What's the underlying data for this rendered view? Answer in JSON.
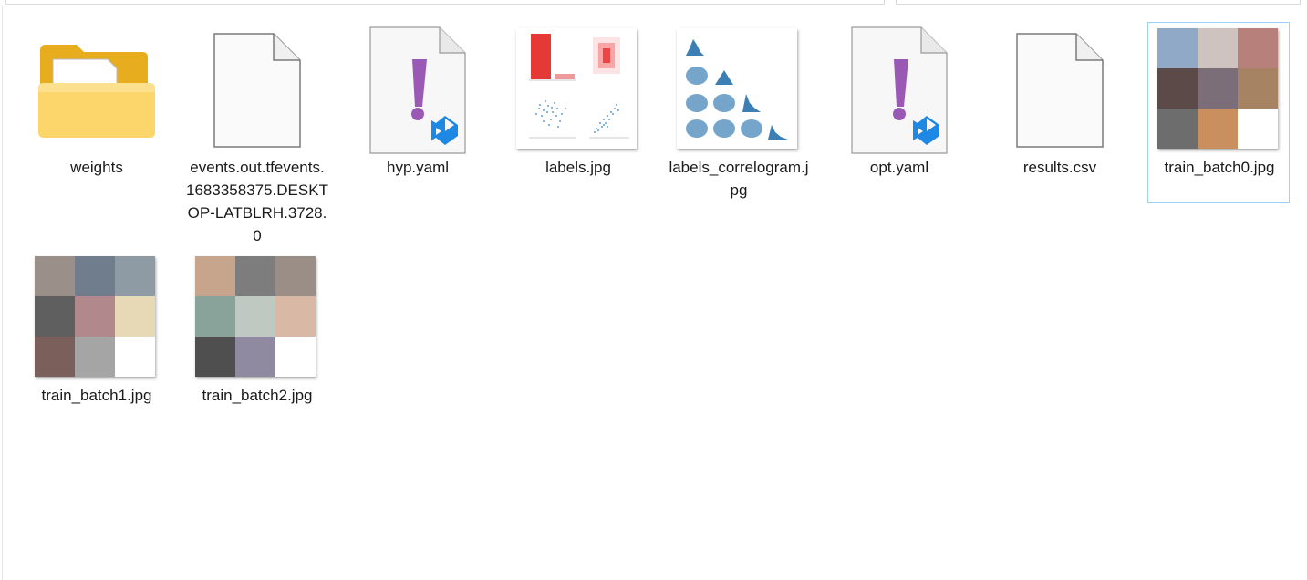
{
  "items": [
    {
      "name": "weights",
      "kind": "folder"
    },
    {
      "name": "events.out.tfevents.1683358375.DESKTOP-LATBLRH.3728.0",
      "kind": "blank-file"
    },
    {
      "name": "hyp.yaml",
      "kind": "yaml-vscode"
    },
    {
      "name": "labels.jpg",
      "kind": "image-labels"
    },
    {
      "name": "labels_correlogram.jpg",
      "kind": "image-correlogram"
    },
    {
      "name": "opt.yaml",
      "kind": "yaml-vscode"
    },
    {
      "name": "results.csv",
      "kind": "blank-file"
    },
    {
      "name": "train_batch0.jpg",
      "kind": "image-batch",
      "selected": true
    },
    {
      "name": "train_batch1.jpg",
      "kind": "image-batch"
    },
    {
      "name": "train_batch2.jpg",
      "kind": "image-batch"
    }
  ],
  "colors": {
    "folder": "#f7c948",
    "yaml_mark": "#9b59b6",
    "vscode_blue": "#1e88e5",
    "selection_border": "#99d1ff",
    "labels_bar": "#e03030",
    "scatter_blue": "#2c7fc4"
  }
}
